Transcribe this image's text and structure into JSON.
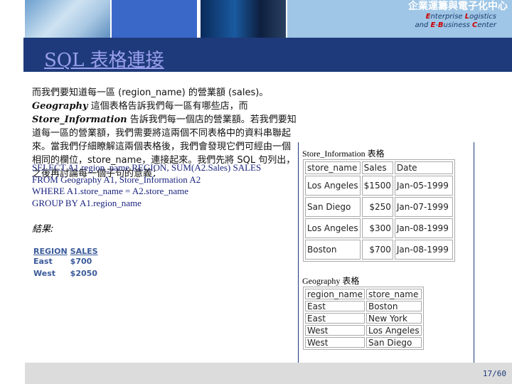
{
  "header": {
    "logo_zh": "企業運籌與電子化中心",
    "logo_en_line1": [
      "E",
      "nterprise ",
      "L",
      "ogistics"
    ],
    "logo_en_line2": [
      "and ",
      "E",
      "-",
      "B",
      "usiness ",
      "C",
      "enter"
    ]
  },
  "title": "SQL 表格連接",
  "paragraph": [
    "而我們要知道每一區 (region_name) 的營業額 (sales)。 ",
    "Geography",
    " 這個表格告訴我們每一區有哪些店，而 ",
    "Store_Information",
    " 告訴我們每一個店的營業額。若我們要知道每一區的營業額，我們需要將這兩個不同表格中的資料串聯起來。當我們仔細瞭解這兩個表格後，我們會發現它們可經由一個相同的欄位，store_name，連接起來。我們先將 SQL 句列出，之後再討論每一個子句的意義："
  ],
  "sql": [
    "SELECT A1.region_name REGION, SUM(A2.Sales) SALES",
    "FROM Geography A1, Store_Information A2",
    "WHERE A1.store_name = A2.store_name",
    "GROUP BY A1.region_name"
  ],
  "result_label": "結果:",
  "result": {
    "headers": [
      "REGION",
      "SALES"
    ],
    "rows": [
      [
        "East",
        "$700"
      ],
      [
        "West",
        "$2050"
      ]
    ]
  },
  "store_information": {
    "caption": "Store_Information 表格",
    "headers": [
      "store_name",
      "Sales",
      "Date"
    ],
    "rows": [
      [
        "Los Angeles",
        "$1500",
        "Jan-05-1999"
      ],
      [
        "San Diego",
        "$250",
        "Jan-07-1999"
      ],
      [
        "Los Angeles",
        "$300",
        "Jan-08-1999"
      ],
      [
        "Boston",
        "$700",
        "Jan-08-1999"
      ]
    ]
  },
  "geography": {
    "caption": "Geography 表格",
    "headers": [
      "region_name",
      "store_name"
    ],
    "rows": [
      [
        "East",
        "Boston"
      ],
      [
        "East",
        "New York"
      ],
      [
        "West",
        "Los Angeles"
      ],
      [
        "West",
        "San Diego"
      ]
    ]
  },
  "footer": {
    "page": "17/60"
  }
}
